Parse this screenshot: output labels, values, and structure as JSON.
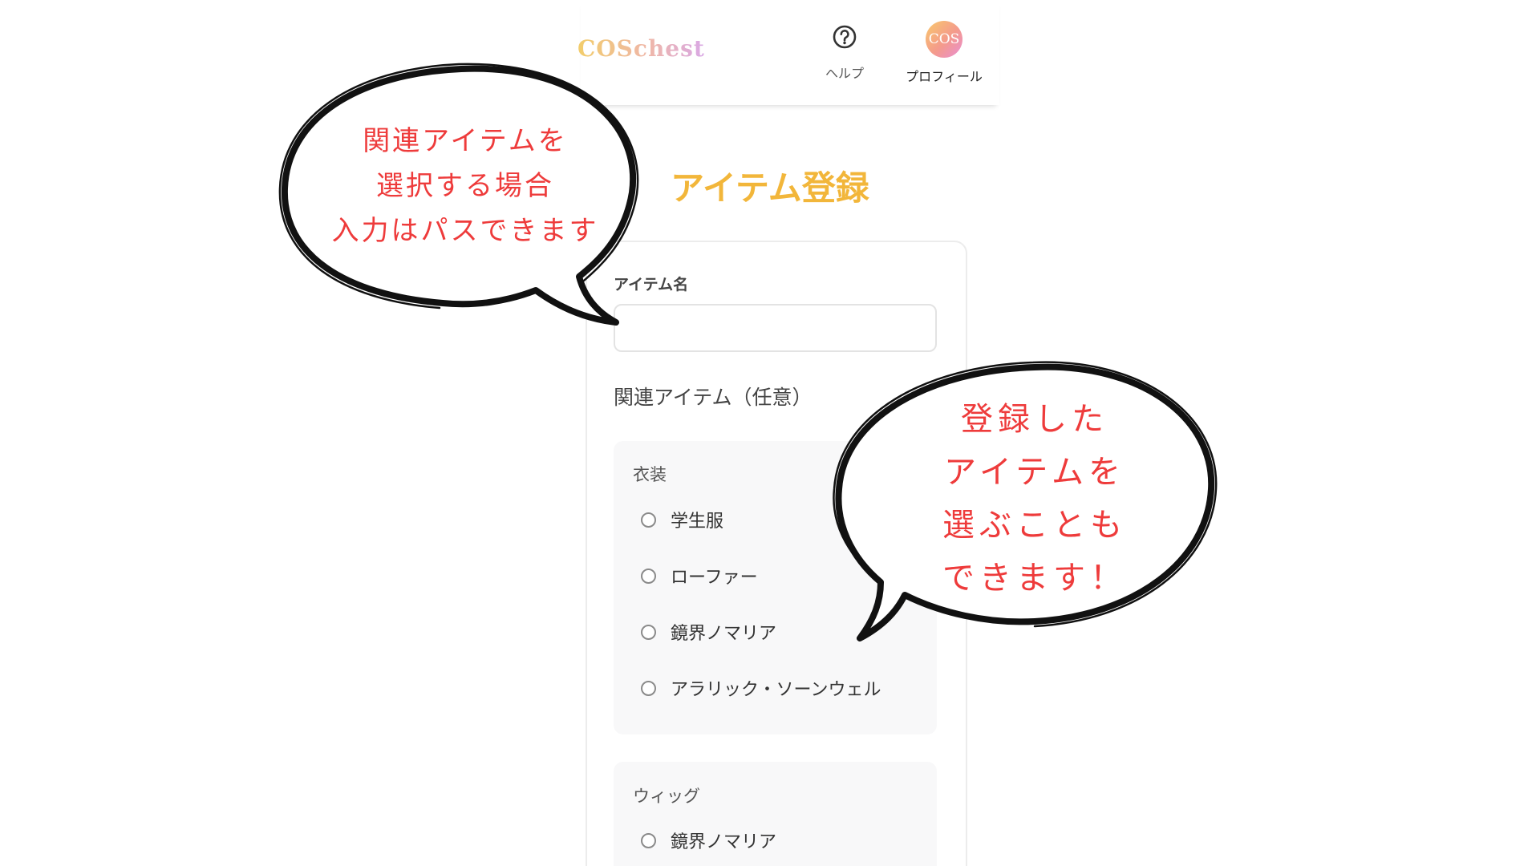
{
  "header": {
    "logo": "COSchest",
    "help_label": "ヘルプ",
    "profile_label": "プロフィール",
    "avatar_text": "COS"
  },
  "page": {
    "title": "アイテム登録"
  },
  "form": {
    "item_name_label": "アイテム名",
    "item_name_value": "",
    "related_items_title": "関連アイテム（任意）",
    "groups": [
      {
        "title": "衣装",
        "options": [
          "学生服",
          "ローファー",
          "鏡界ノマリア",
          "アラリック・ソーンウェル"
        ]
      },
      {
        "title": "ウィッグ",
        "options": [
          "鏡界ノマリア"
        ]
      }
    ]
  },
  "callouts": {
    "left": [
      "関連アイテムを",
      "選択する場合",
      "入力はパスできます"
    ],
    "right": [
      "登録した",
      "アイテムを",
      "選ぶことも",
      "できます！"
    ]
  },
  "colors": {
    "title": "#f2b63a",
    "callout_text": "#ee3b3b",
    "callout_outline": "#111111"
  },
  "icons": {
    "help": "question-circle-icon",
    "radio": "radio-unchecked"
  }
}
